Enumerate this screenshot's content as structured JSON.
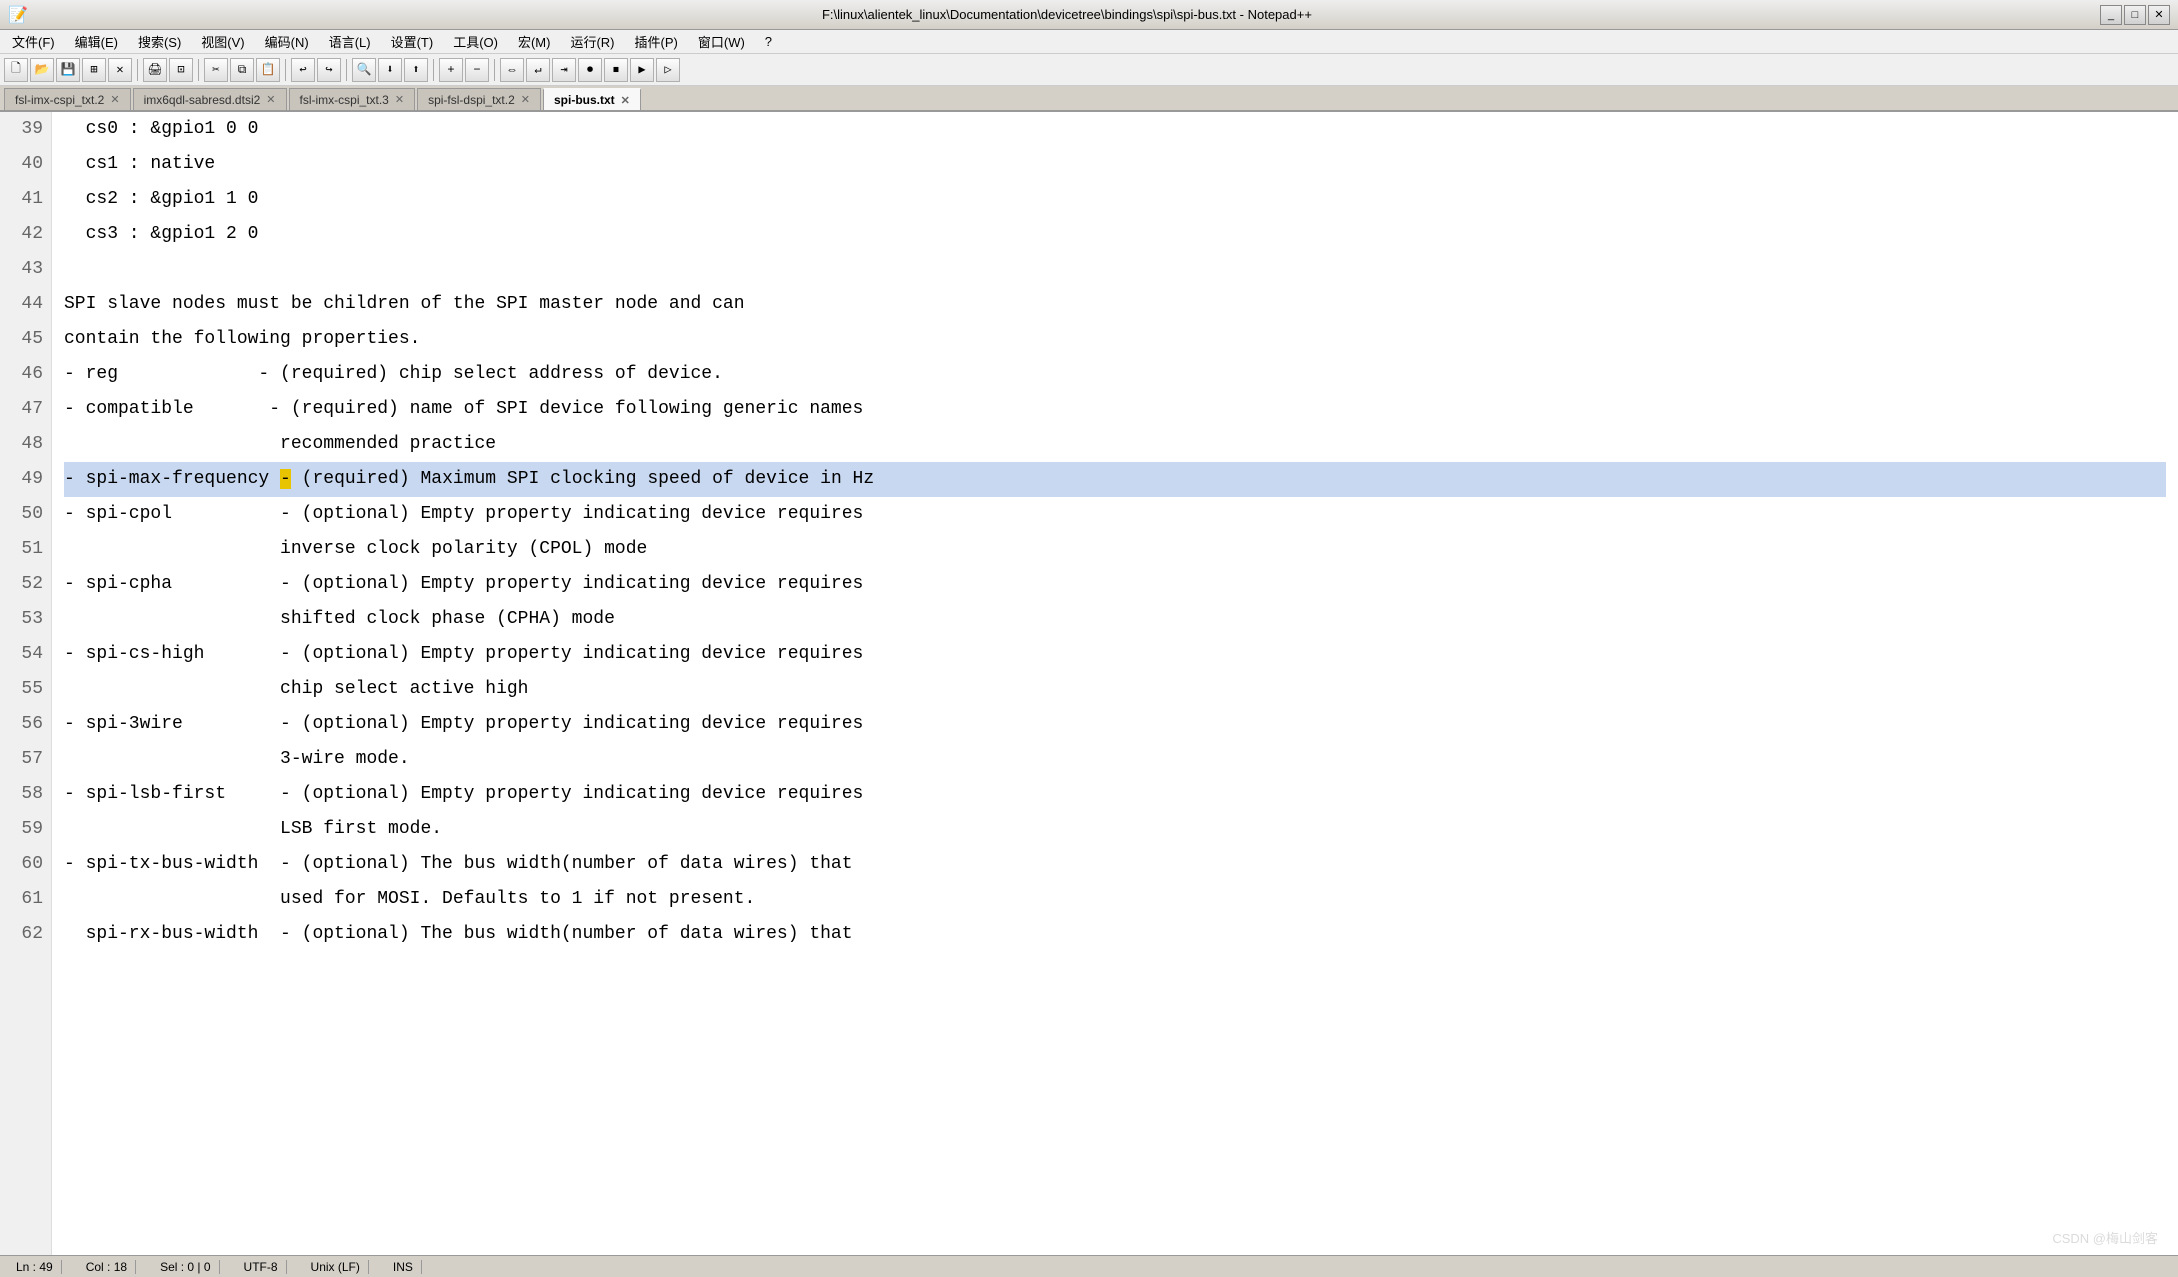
{
  "window": {
    "title": "F:\\linux\\alientek_linux\\Documentation\\devicetree\\bindings\\spi\\spi-bus.txt - Notepad++"
  },
  "menu": {
    "items": [
      "文件(F)",
      "编辑(E)",
      "搜索(S)",
      "视图(V)",
      "编码(N)",
      "语言(L)",
      "设置(T)",
      "工具(O)",
      "宏(M)",
      "运行(R)",
      "插件(P)",
      "窗口(W)",
      "?"
    ]
  },
  "tabs": [
    {
      "label": "fsl-imx-cspi_txt.2",
      "active": false
    },
    {
      "label": "imx6qdl-sabresd.dtsi2",
      "active": false
    },
    {
      "label": "fsl-imx-cspi_txt.3",
      "active": false
    },
    {
      "label": "spi-fsl-dspi_txt.2",
      "active": false
    },
    {
      "label": "spi-bus.txt",
      "active": true
    }
  ],
  "lines": [
    {
      "num": "39",
      "text": "  cs0 : &gpio1 0 0",
      "highlight": false,
      "selected": false
    },
    {
      "num": "40",
      "text": "  cs1 : native",
      "highlight": false,
      "selected": false
    },
    {
      "num": "41",
      "text": "  cs2 : &gpio1 1 0",
      "highlight": false,
      "selected": false
    },
    {
      "num": "42",
      "text": "  cs3 : &gpio1 2 0",
      "highlight": false,
      "selected": false
    },
    {
      "num": "43",
      "text": "",
      "highlight": false,
      "selected": false
    },
    {
      "num": "44",
      "text": "SPI slave nodes must be children of the SPI master node and can",
      "highlight": false,
      "selected": false
    },
    {
      "num": "45",
      "text": "contain the following properties.",
      "highlight": false,
      "selected": false
    },
    {
      "num": "46",
      "text": "- reg             - (required) chip select address of device.",
      "highlight": false,
      "selected": false
    },
    {
      "num": "47",
      "text": "- compatible       - (required) name of SPI device following generic names",
      "highlight": false,
      "selected": false
    },
    {
      "num": "48",
      "text": "                    recommended practice",
      "highlight": false,
      "selected": false
    },
    {
      "num": "49",
      "text": "- spi-max-frequency - (required) Maximum SPI clocking speed of device in Hz",
      "highlight": true,
      "selected": false
    },
    {
      "num": "50",
      "text": "- spi-cpol          - (optional) Empty property indicating device requires",
      "highlight": false,
      "selected": false
    },
    {
      "num": "51",
      "text": "                    inverse clock polarity (CPOL) mode",
      "highlight": false,
      "selected": false
    },
    {
      "num": "52",
      "text": "- spi-cpha          - (optional) Empty property indicating device requires",
      "highlight": false,
      "selected": false
    },
    {
      "num": "53",
      "text": "                    shifted clock phase (CPHA) mode",
      "highlight": false,
      "selected": false
    },
    {
      "num": "54",
      "text": "- spi-cs-high       - (optional) Empty property indicating device requires",
      "highlight": false,
      "selected": false
    },
    {
      "num": "55",
      "text": "                    chip select active high",
      "highlight": false,
      "selected": false
    },
    {
      "num": "56",
      "text": "- spi-3wire         - (optional) Empty property indicating device requires",
      "highlight": false,
      "selected": false
    },
    {
      "num": "57",
      "text": "                    3-wire mode.",
      "highlight": false,
      "selected": false
    },
    {
      "num": "58",
      "text": "- spi-lsb-first     - (optional) Empty property indicating device requires",
      "highlight": false,
      "selected": false
    },
    {
      "num": "59",
      "text": "                    LSB first mode.",
      "highlight": false,
      "selected": false
    },
    {
      "num": "60",
      "text": "- spi-tx-bus-width  - (optional) The bus width(number of data wires) that",
      "highlight": false,
      "selected": false
    },
    {
      "num": "61",
      "text": "                    used for MOSI. Defaults to 1 if not present.",
      "highlight": false,
      "selected": false
    },
    {
      "num": "62",
      "text": "  spi-rx-bus-width  - (optional) The bus width(number of data wires) that",
      "highlight": false,
      "selected": false
    }
  ],
  "status": {
    "line": "Ln : 49",
    "col": "Col : 18",
    "sel": "Sel : 0 | 0",
    "encoding": "UTF-8",
    "lineending": "Unix (LF)",
    "insertmode": "INS"
  },
  "watermark": "CSDN @梅山剑客"
}
